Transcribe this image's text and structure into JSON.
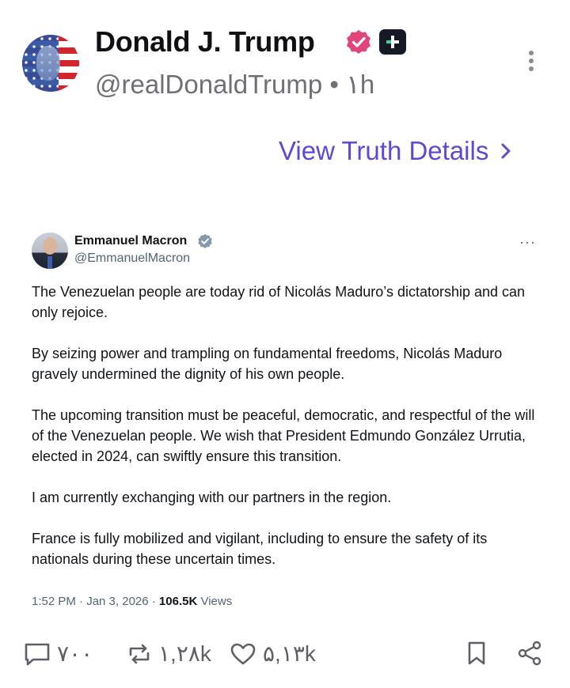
{
  "post": {
    "author_name": "Donald J. Trump",
    "handle_text": "@realDonaldTrump",
    "separator": "•",
    "time_ago": "۱h",
    "view_details_label": "View Truth Details"
  },
  "embedded_tweet": {
    "author_name": "Emmanuel Macron",
    "handle": "@EmmanuelMacron",
    "more_label": "···",
    "paragraphs": [
      "The Venezuelan people are today rid of Nicolás Maduro’s dictatorship and can only rejoice.",
      "By seizing power and trampling on fundamental freedoms, Nicolás Maduro gravely undermined the dignity of his own people.",
      "The upcoming transition must be peaceful, democratic, and respectful of the will of the Venezuelan people. We wish that President Edmundo González Urrutia, elected in 2024, can swiftly ensure this transition.",
      "I am currently exchanging with our partners in the region.",
      "France is fully mobilized and vigilant, including to ensure the safety of its nationals during these uncertain times."
    ],
    "timestamp": "1:52 PM · Jan 3, 2026 · ",
    "views_count": "106.5K",
    "views_label": " Views"
  },
  "actions": {
    "replies": "۷۰۰",
    "retruths": "۱,۲۸k",
    "likes": "۵,۱۳k"
  },
  "colors": {
    "accent": "#5d49d3",
    "verified_pink": "#e0457b",
    "verified_gray": "#829aab",
    "muted": "#6f6f77"
  },
  "icons": [
    "verified-badge-icon",
    "plus-icon",
    "more-vertical-icon",
    "chevron-right-icon",
    "more-horizontal-icon",
    "reply-icon",
    "retruth-icon",
    "like-icon",
    "bookmark-icon",
    "share-icon"
  ]
}
